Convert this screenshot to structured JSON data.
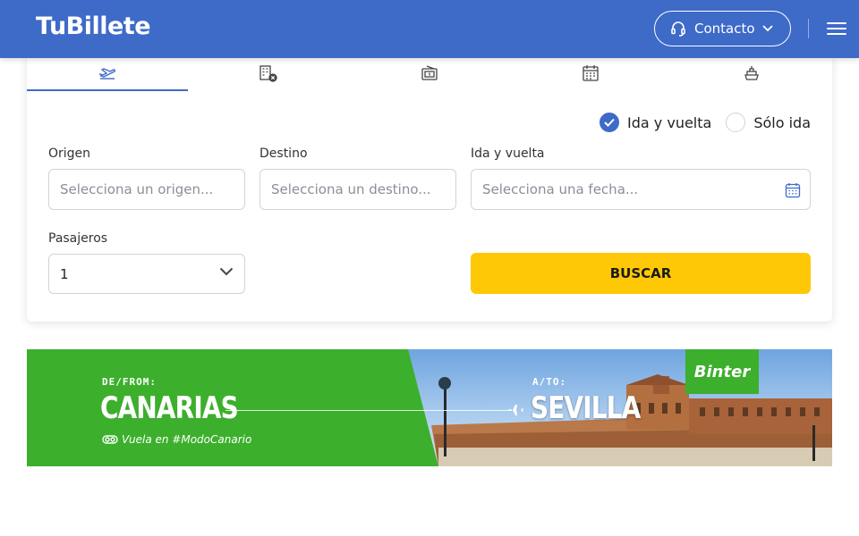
{
  "header": {
    "logo": "TuBillete",
    "contact_label": "Contacto"
  },
  "tabs": [
    {
      "icon": "plane-takeoff-icon",
      "active": true
    },
    {
      "icon": "hotel-cancel-icon",
      "active": false
    },
    {
      "icon": "ticket-icon",
      "active": false
    },
    {
      "icon": "calendar-icon",
      "active": false
    },
    {
      "icon": "ship-icon",
      "active": false
    }
  ],
  "trip_type": {
    "round_trip": "Ida y vuelta",
    "one_way": "Sólo ida",
    "selected": "round_trip"
  },
  "form": {
    "origin_label": "Origen",
    "origin_placeholder": "Selecciona un origen...",
    "destination_label": "Destino",
    "destination_placeholder": "Selecciona un destino...",
    "dates_label": "Ida y vuelta",
    "dates_placeholder": "Selecciona una fecha...",
    "passengers_label": "Pasajeros",
    "passengers_value": "1",
    "search_button": "BUSCAR"
  },
  "banner": {
    "from_label": "DE/FROM:",
    "origin": "CANARIAS",
    "tagline": "Vuela en #ModoCanario",
    "to_label": "A/TO:",
    "destination": "SEVILLA",
    "brand": "Binter",
    "brand_color": "#3caf2c"
  },
  "colors": {
    "header": "#3e6ac8",
    "accent": "#3e6ac8",
    "search_button": "#ffc806"
  }
}
